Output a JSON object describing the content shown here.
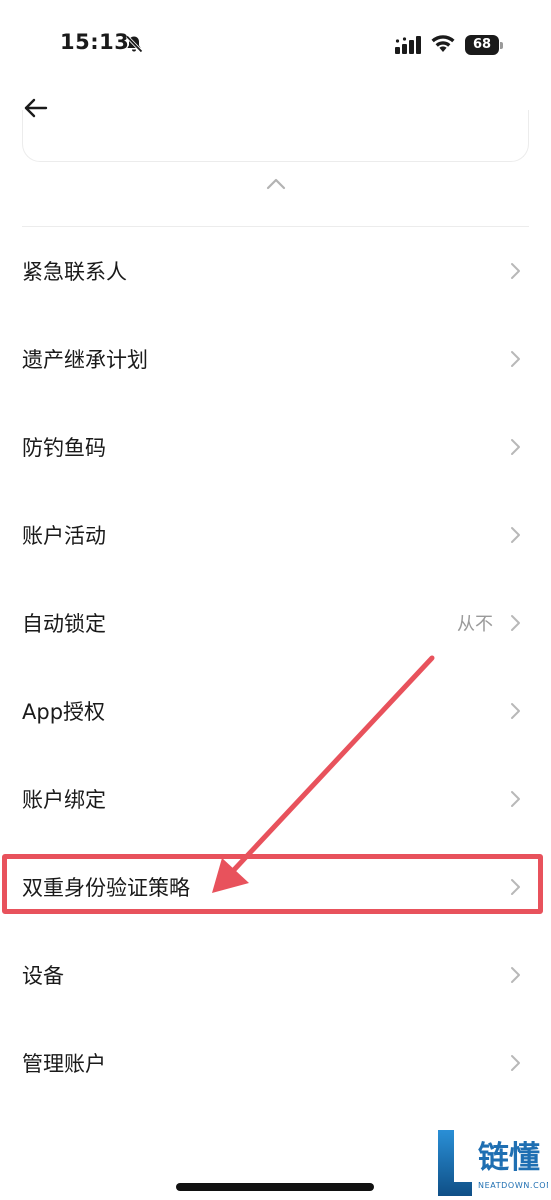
{
  "status_bar": {
    "time": "15:13",
    "battery": "68",
    "icons": [
      "bell-slash-icon",
      "signal-icon",
      "wifi-icon",
      "battery-icon"
    ]
  },
  "header": {
    "back_icon": "arrow-left-icon",
    "collapse_icon": "chevron-up-icon"
  },
  "menu": [
    {
      "label": "紧急联系人",
      "value": ""
    },
    {
      "label": "遗产继承计划",
      "value": ""
    },
    {
      "label": "防钓鱼码",
      "value": ""
    },
    {
      "label": "账户活动",
      "value": ""
    },
    {
      "label": "自动锁定",
      "value": "从不"
    },
    {
      "label": "App授权",
      "value": ""
    },
    {
      "label": "账户绑定",
      "value": ""
    },
    {
      "label": "双重身份验证策略",
      "value": ""
    },
    {
      "label": "设备",
      "value": ""
    },
    {
      "label": "管理账户",
      "value": ""
    }
  ],
  "annotation": {
    "highlighted_item": "双重身份验证策略",
    "color": "#e8525c"
  },
  "watermark": {
    "logo_text": "链懂",
    "sub_text": "NEATDOWN.COM"
  }
}
